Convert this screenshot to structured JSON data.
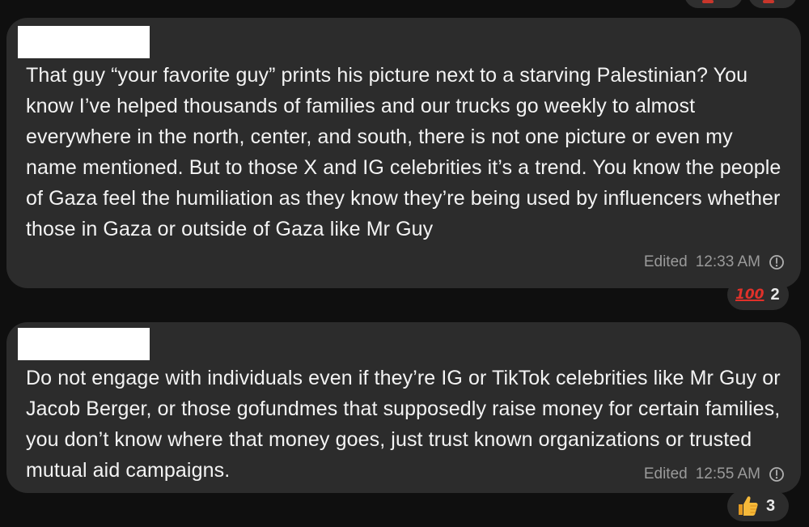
{
  "messages": [
    {
      "text": "That guy “your favorite guy” prints his picture next to a starving Palestinian? You know I’ve helped thousands of families and our trucks go weekly to almost everywhere in the north, center, and south, there is not one picture or even my name mentioned. But to those X and IG celebrities it’s a trend. You know the people of Gaza feel the humiliation as they know they’re being used by influencers whether those in Gaza or outside of Gaza like Mr Guy",
      "edited_label": "Edited",
      "time": "12:33 AM",
      "reaction": {
        "emoji": "💯",
        "emoji_text": "100",
        "count": "2"
      }
    },
    {
      "text": "Do not engage with individuals even if they’re IG or TikTok celebrities like Mr Guy or Jacob Berger, or those gofundmes that supposedly raise money for certain families, you don’t know where that money goes, just trust known organizations or trusted mutual aid campaigns.",
      "edited_label": "Edited",
      "time": "12:55 AM",
      "reaction": {
        "emoji": "👍",
        "count": "3"
      }
    }
  ],
  "icons": {
    "status": "clock-icon",
    "reaction_1": "hundred-points-icon",
    "reaction_2": "thumbs-up-icon"
  },
  "colors": {
    "background": "#0f0f0f",
    "bubble": "#2c2c2c",
    "text": "#f3f3f3",
    "meta": "#9a9a9a",
    "hundred_red": "#e0312a",
    "thumb_yellow": "#f5b93a"
  }
}
